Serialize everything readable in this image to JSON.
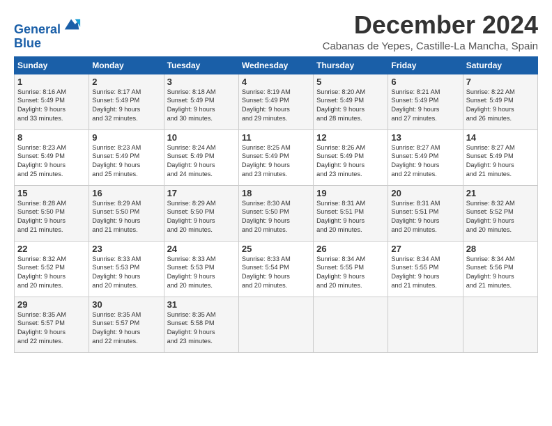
{
  "logo": {
    "line1": "General",
    "line2": "Blue"
  },
  "title": "December 2024",
  "location": "Cabanas de Yepes, Castille-La Mancha, Spain",
  "weekdays": [
    "Sunday",
    "Monday",
    "Tuesday",
    "Wednesday",
    "Thursday",
    "Friday",
    "Saturday"
  ],
  "weeks": [
    [
      {
        "day": "1",
        "sunrise": "8:16 AM",
        "sunset": "5:49 PM",
        "daylight_hours": "9 hours",
        "daylight_min": "and 33 minutes."
      },
      {
        "day": "2",
        "sunrise": "8:17 AM",
        "sunset": "5:49 PM",
        "daylight_hours": "9 hours",
        "daylight_min": "and 32 minutes."
      },
      {
        "day": "3",
        "sunrise": "8:18 AM",
        "sunset": "5:49 PM",
        "daylight_hours": "9 hours",
        "daylight_min": "and 30 minutes."
      },
      {
        "day": "4",
        "sunrise": "8:19 AM",
        "sunset": "5:49 PM",
        "daylight_hours": "9 hours",
        "daylight_min": "and 29 minutes."
      },
      {
        "day": "5",
        "sunrise": "8:20 AM",
        "sunset": "5:49 PM",
        "daylight_hours": "9 hours",
        "daylight_min": "and 28 minutes."
      },
      {
        "day": "6",
        "sunrise": "8:21 AM",
        "sunset": "5:49 PM",
        "daylight_hours": "9 hours",
        "daylight_min": "and 27 minutes."
      },
      {
        "day": "7",
        "sunrise": "8:22 AM",
        "sunset": "5:49 PM",
        "daylight_hours": "9 hours",
        "daylight_min": "and 26 minutes."
      }
    ],
    [
      {
        "day": "8",
        "sunrise": "8:23 AM",
        "sunset": "5:49 PM",
        "daylight_hours": "9 hours",
        "daylight_min": "and 25 minutes."
      },
      {
        "day": "9",
        "sunrise": "8:23 AM",
        "sunset": "5:49 PM",
        "daylight_hours": "9 hours",
        "daylight_min": "and 25 minutes."
      },
      {
        "day": "10",
        "sunrise": "8:24 AM",
        "sunset": "5:49 PM",
        "daylight_hours": "9 hours",
        "daylight_min": "and 24 minutes."
      },
      {
        "day": "11",
        "sunrise": "8:25 AM",
        "sunset": "5:49 PM",
        "daylight_hours": "9 hours",
        "daylight_min": "and 23 minutes."
      },
      {
        "day": "12",
        "sunrise": "8:26 AM",
        "sunset": "5:49 PM",
        "daylight_hours": "9 hours",
        "daylight_min": "and 23 minutes."
      },
      {
        "day": "13",
        "sunrise": "8:27 AM",
        "sunset": "5:49 PM",
        "daylight_hours": "9 hours",
        "daylight_min": "and 22 minutes."
      },
      {
        "day": "14",
        "sunrise": "8:27 AM",
        "sunset": "5:49 PM",
        "daylight_hours": "9 hours",
        "daylight_min": "and 21 minutes."
      }
    ],
    [
      {
        "day": "15",
        "sunrise": "8:28 AM",
        "sunset": "5:50 PM",
        "daylight_hours": "9 hours",
        "daylight_min": "and 21 minutes."
      },
      {
        "day": "16",
        "sunrise": "8:29 AM",
        "sunset": "5:50 PM",
        "daylight_hours": "9 hours",
        "daylight_min": "and 21 minutes."
      },
      {
        "day": "17",
        "sunrise": "8:29 AM",
        "sunset": "5:50 PM",
        "daylight_hours": "9 hours",
        "daylight_min": "and 20 minutes."
      },
      {
        "day": "18",
        "sunrise": "8:30 AM",
        "sunset": "5:50 PM",
        "daylight_hours": "9 hours",
        "daylight_min": "and 20 minutes."
      },
      {
        "day": "19",
        "sunrise": "8:31 AM",
        "sunset": "5:51 PM",
        "daylight_hours": "9 hours",
        "daylight_min": "and 20 minutes."
      },
      {
        "day": "20",
        "sunrise": "8:31 AM",
        "sunset": "5:51 PM",
        "daylight_hours": "9 hours",
        "daylight_min": "and 20 minutes."
      },
      {
        "day": "21",
        "sunrise": "8:32 AM",
        "sunset": "5:52 PM",
        "daylight_hours": "9 hours",
        "daylight_min": "and 20 minutes."
      }
    ],
    [
      {
        "day": "22",
        "sunrise": "8:32 AM",
        "sunset": "5:52 PM",
        "daylight_hours": "9 hours",
        "daylight_min": "and 20 minutes."
      },
      {
        "day": "23",
        "sunrise": "8:33 AM",
        "sunset": "5:53 PM",
        "daylight_hours": "9 hours",
        "daylight_min": "and 20 minutes."
      },
      {
        "day": "24",
        "sunrise": "8:33 AM",
        "sunset": "5:53 PM",
        "daylight_hours": "9 hours",
        "daylight_min": "and 20 minutes."
      },
      {
        "day": "25",
        "sunrise": "8:33 AM",
        "sunset": "5:54 PM",
        "daylight_hours": "9 hours",
        "daylight_min": "and 20 minutes."
      },
      {
        "day": "26",
        "sunrise": "8:34 AM",
        "sunset": "5:55 PM",
        "daylight_hours": "9 hours",
        "daylight_min": "and 20 minutes."
      },
      {
        "day": "27",
        "sunrise": "8:34 AM",
        "sunset": "5:55 PM",
        "daylight_hours": "9 hours",
        "daylight_min": "and 21 minutes."
      },
      {
        "day": "28",
        "sunrise": "8:34 AM",
        "sunset": "5:56 PM",
        "daylight_hours": "9 hours",
        "daylight_min": "and 21 minutes."
      }
    ],
    [
      {
        "day": "29",
        "sunrise": "8:35 AM",
        "sunset": "5:57 PM",
        "daylight_hours": "9 hours",
        "daylight_min": "and 22 minutes."
      },
      {
        "day": "30",
        "sunrise": "8:35 AM",
        "sunset": "5:57 PM",
        "daylight_hours": "9 hours",
        "daylight_min": "and 22 minutes."
      },
      {
        "day": "31",
        "sunrise": "8:35 AM",
        "sunset": "5:58 PM",
        "daylight_hours": "9 hours",
        "daylight_min": "and 23 minutes."
      },
      null,
      null,
      null,
      null
    ]
  ]
}
